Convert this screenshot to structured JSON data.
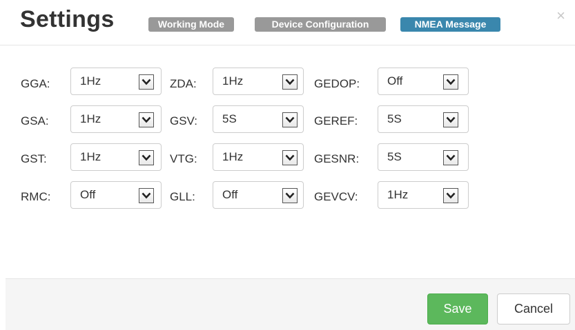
{
  "header": {
    "title": "Settings",
    "tabs": [
      {
        "label": "Working Mode",
        "active": false
      },
      {
        "label": "Device Configuration",
        "active": false
      },
      {
        "label": "NMEA Message",
        "active": true
      }
    ],
    "close_glyph": "×"
  },
  "fields": {
    "gga": {
      "label": "GGA:",
      "value": "1Hz"
    },
    "gsa": {
      "label": "GSA:",
      "value": "1Hz"
    },
    "gst": {
      "label": "GST:",
      "value": "1Hz"
    },
    "rmc": {
      "label": "RMC:",
      "value": "Off"
    },
    "zda": {
      "label": "ZDA:",
      "value": "1Hz"
    },
    "gsv": {
      "label": "GSV:",
      "value": "5S"
    },
    "vtg": {
      "label": "VTG:",
      "value": "1Hz"
    },
    "gll": {
      "label": "GLL:",
      "value": "Off"
    },
    "gedop": {
      "label": "GEDOP:",
      "value": "Off"
    },
    "geref": {
      "label": "GEREF:",
      "value": "5S"
    },
    "gesnr": {
      "label": "GESNR:",
      "value": "5S"
    },
    "gevcv": {
      "label": "GEVCV:",
      "value": "1Hz"
    }
  },
  "footer": {
    "save_label": "Save",
    "cancel_label": "Cancel"
  },
  "colors": {
    "active_tab": "#3a87ad",
    "inactive_tab": "#999999",
    "save_button": "#5cb85c"
  },
  "icons": {
    "dropdown": "chevron-down-icon",
    "close": "close-icon"
  }
}
